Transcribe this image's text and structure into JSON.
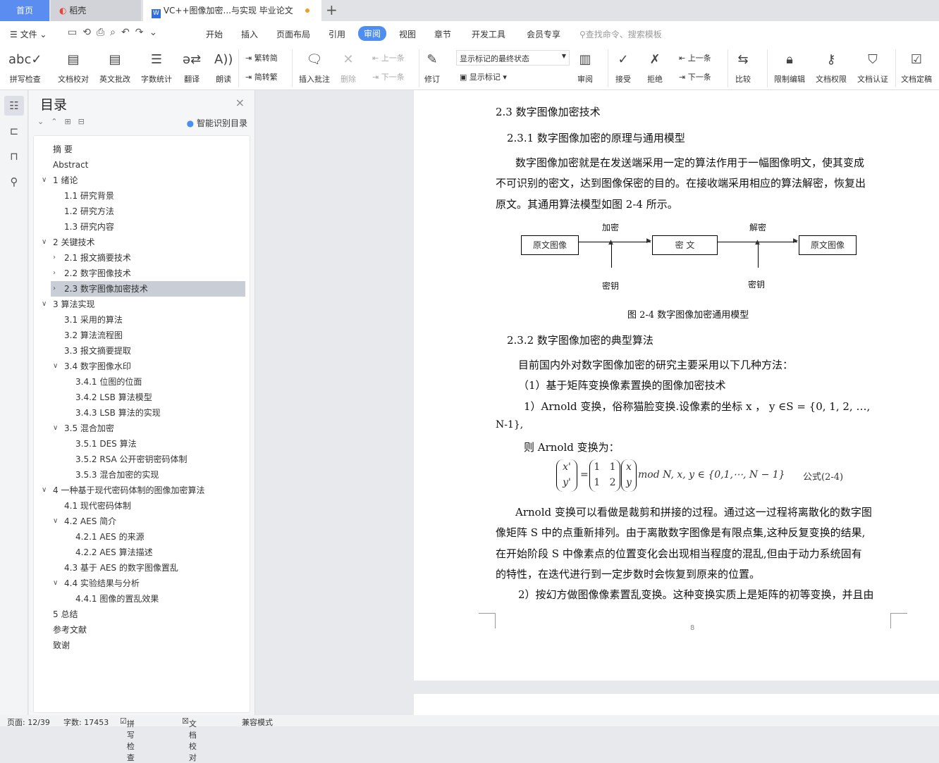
{
  "tabs": {
    "home": "首页",
    "daoke": "稻壳",
    "doc": "VC++图像加密...与实现 毕业论文"
  },
  "menu": {
    "file": "文件",
    "items": [
      "开始",
      "插入",
      "页面布局",
      "引用",
      "审阅",
      "视图",
      "章节",
      "开发工具",
      "会员专享"
    ],
    "active": "审阅",
    "search": "查找命令、搜索模板"
  },
  "ribbon": {
    "spell": "拼写检查",
    "proof": "文档校对",
    "en": "英文批改",
    "count": "字数统计",
    "translate": "翻译",
    "read": "朗读",
    "t2s": "繁转简",
    "s2t": "简转繁",
    "insert_comment": "插入批注",
    "delete": "删除",
    "prev_comment": "上一条",
    "next_comment": "下一条",
    "revise": "修订",
    "markup_state": "显示标记的最终状态",
    "show_markup": "显示标记",
    "review": "审阅",
    "accept": "接受",
    "reject": "拒绝",
    "prev": "上一条",
    "next": "下一条",
    "compare": "比较",
    "restrict": "限制编辑",
    "perm": "文档权限",
    "cert": "文档认证",
    "final": "文档定稿"
  },
  "toc": {
    "title": "目录",
    "smart": "智能识别目录",
    "items": [
      {
        "t": "摘 要",
        "l": 0,
        "c": ""
      },
      {
        "t": "Abstract",
        "l": 0,
        "c": ""
      },
      {
        "t": "1  绪论",
        "l": 0,
        "c": "v"
      },
      {
        "t": "1.1  研究背景",
        "l": 1,
        "c": ""
      },
      {
        "t": "1.2  研究方法",
        "l": 1,
        "c": ""
      },
      {
        "t": "1.3  研究内容",
        "l": 1,
        "c": ""
      },
      {
        "t": "2  关键技术",
        "l": 0,
        "c": "v"
      },
      {
        "t": "2.1  报文摘要技术",
        "l": 1,
        "c": ">"
      },
      {
        "t": "2.2  数字图像技术",
        "l": 1,
        "c": ">"
      },
      {
        "t": "2.3  数字图像加密技术",
        "l": 1,
        "c": ">",
        "sel": true
      },
      {
        "t": "3  算法实现",
        "l": 0,
        "c": "v"
      },
      {
        "t": "3.1  采用的算法",
        "l": 1,
        "c": ""
      },
      {
        "t": "3.2  算法流程图",
        "l": 1,
        "c": ""
      },
      {
        "t": "3.3  报文摘要提取",
        "l": 1,
        "c": ""
      },
      {
        "t": "3.4  数字图像水印",
        "l": 1,
        "c": "v"
      },
      {
        "t": "3.4.1  位图的位面",
        "l": 2,
        "c": ""
      },
      {
        "t": "3.4.2 LSB 算法模型",
        "l": 2,
        "c": ""
      },
      {
        "t": "3.4.3 LSB 算法的实现",
        "l": 2,
        "c": ""
      },
      {
        "t": "3.5  混合加密",
        "l": 1,
        "c": "v"
      },
      {
        "t": "3.5.1 DES 算法",
        "l": 2,
        "c": ""
      },
      {
        "t": "3.5.2 RSA 公开密钥密码体制",
        "l": 2,
        "c": ""
      },
      {
        "t": "3.5.3  混合加密的实现",
        "l": 2,
        "c": ""
      },
      {
        "t": "4  一种基于现代密码体制的图像加密算法",
        "l": 0,
        "c": "v"
      },
      {
        "t": "4.1 现代密码体制",
        "l": 1,
        "c": ""
      },
      {
        "t": "4.2 AES 简介",
        "l": 1,
        "c": "v"
      },
      {
        "t": "4.2.1 AES 的来源",
        "l": 2,
        "c": ""
      },
      {
        "t": "4.2.2 AES 算法描述",
        "l": 2,
        "c": ""
      },
      {
        "t": "4.3  基于 AES 的数字图像置乱",
        "l": 1,
        "c": ""
      },
      {
        "t": "4.4  实验结果与分析",
        "l": 1,
        "c": "v"
      },
      {
        "t": "4.4.1  图像的置乱效果",
        "l": 2,
        "c": ""
      },
      {
        "t": "5  总结",
        "l": 0,
        "c": ""
      },
      {
        "t": "参考文献",
        "l": 0,
        "c": ""
      },
      {
        "t": "致谢",
        "l": 0,
        "c": ""
      }
    ]
  },
  "doc": {
    "h1": "2.3  数字图像加密技术",
    "h2a": "2.3.1  数字图像加密的原理与通用模型",
    "p1": [
      "数字图像加密就是在发送端采用一定的算法作用于一幅图像明文，使其变成",
      "不可识别的密文，达到图像保密的目的。在接收端采用相应的算法解密，恢复出",
      "原文。其通用算法模型如图 2-4 所示。"
    ],
    "fig": {
      "enc": "加密",
      "dec": "解密",
      "src": "原文图像",
      "cipher": "密  文",
      "dst": "原文图像",
      "key1": "密钥",
      "key2": "密钥",
      "caption": "图 2-4  数字图像加密通用模型"
    },
    "h2b": "2.3.2  数字图像加密的典型算法",
    "p2": [
      "目前国内外对数字图像加密的研究主要采用以下几种方法：",
      "（1）基于矩阵变换像素置换的图像加密技术",
      "1）Arnold 变换，俗称猫脸变换.设像素的坐标 x ， y ∈S = {0,  1,  2,  …,",
      "N-1},",
      "则 Arnold 变换为："
    ],
    "formula": {
      "lhs": [
        "x'",
        "y'"
      ],
      "m": [
        "1",
        "1",
        "1",
        "2"
      ],
      "v": [
        "x",
        "y"
      ],
      "tail": "mod N, x, y ∈ {0,1,⋯, N − 1}",
      "label": "公式(2-4)"
    },
    "p3": [
      "Arnold 变换可以看做是裁剪和拼接的过程。通过这一过程将离散化的数字图",
      "像矩阵 S 中的点重新排列。由于离散数字图像是有限点集,这种反复变换的结果,",
      "在开始阶段 S 中像素点的位置变化会出现相当程度的混乱,但由于动力系统固有",
      "的特性，在迭代进行到一定步数时会恢复到原来的位置。",
      "2）按幻方做图像像素置乱变换。这种变换实质上是矩阵的初等变换，并且由"
    ],
    "page_num": "8"
  },
  "status": {
    "page": "页面: 12/39",
    "words": "字数: 17453",
    "spell": "拼写检查",
    "proof": "文档校对",
    "compat": "兼容模式"
  },
  "colors": {
    "accent": "#4e8ef2",
    "home_tab": "#5b8cf0",
    "selected_toc": "#c8cdd6"
  }
}
